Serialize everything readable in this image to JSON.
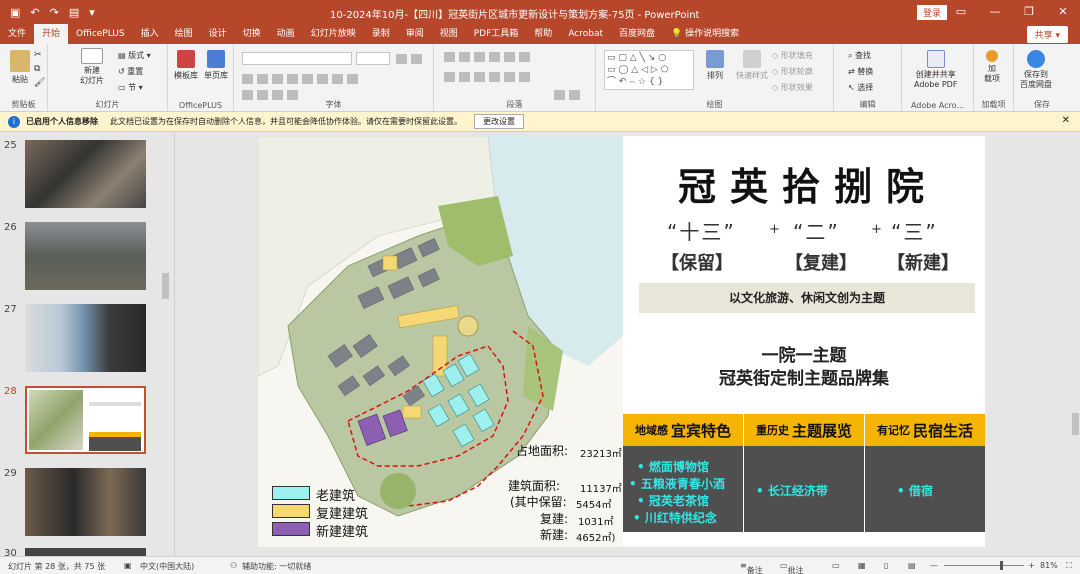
{
  "window": {
    "title": "10-2024年10月-【四川】冠英街片区城市更新设计与策划方案-75页 - PowerPoint",
    "login": "登录"
  },
  "tabs": [
    "文件",
    "开始",
    "OfficePLUS",
    "插入",
    "绘图",
    "设计",
    "切换",
    "动画",
    "幻灯片放映",
    "录制",
    "审阅",
    "视图",
    "PDF工具箱",
    "帮助",
    "Acrobat",
    "百度网盘",
    "操作说明搜索"
  ],
  "share": "共享",
  "ribbon": {
    "groups": [
      "剪贴板",
      "幻灯片",
      "OfficePLUS",
      "字体",
      "段落",
      "绘图",
      "编辑",
      "Adobe Acro...",
      "加载项",
      "保存"
    ],
    "paste": "粘贴",
    "new_slide": "新建\n幻灯片",
    "layout": "版式",
    "reset": "重置",
    "section": "节",
    "template_lib": "模板库",
    "single_lib": "单页库",
    "arrange": "排列",
    "quick_styles": "快速样式",
    "shape_fill": "形状填充",
    "shape_outline": "形状轮廓",
    "shape_effect": "形状效果",
    "find": "查找",
    "replace": "替换",
    "select": "选择",
    "create_share_pdf": "创建并共享\nAdobe PDF",
    "addins": "加\n载项",
    "save_baidu": "保存到\n百度网盘"
  },
  "infobar": {
    "title": "已启用个人信息移除",
    "message": "此文档已设置为在保存时自动删除个人信息，并且可能会降低协作体验。请仅在需要时保留此设置。",
    "button": "更改设置"
  },
  "thumbnails": [
    {
      "num": "25",
      "active": false
    },
    {
      "num": "26",
      "active": false
    },
    {
      "num": "27",
      "active": false
    },
    {
      "num": "28",
      "active": true
    },
    {
      "num": "29",
      "active": false
    },
    {
      "num": "30",
      "active": false
    }
  ],
  "slide": {
    "title": "冠英拾捌院",
    "num1": "“十三”",
    "num2": "“二”",
    "num3": "“三”",
    "plus": "+",
    "bracket1": "【保留】",
    "bracket2": "【复建】",
    "bracket3": "【新建】",
    "theme": "以文化旅游、休闲文创为主题",
    "sub1": "一院一主题",
    "sub2": "冠英街定制主题品牌集",
    "categories": [
      {
        "small": "地域感",
        "big": "宜宾特色",
        "items": [
          "燃面博物馆",
          "五粮液青春小酒",
          "冠英老茶馆",
          "川红特供纪念"
        ]
      },
      {
        "small": "重历史",
        "big": "主题展览",
        "items": [
          "长江经济带"
        ]
      },
      {
        "small": "有记忆",
        "big": "民宿生活",
        "items": [
          "借宿"
        ]
      }
    ],
    "stats": {
      "land_label": "占地面积:",
      "land_value": "23213㎡",
      "build_label": "建筑面积:",
      "build_value": "11137㎡",
      "keep_label": "(其中保留:",
      "keep_value": "5454㎡",
      "rebuild_label": "复建:",
      "rebuild_value": "1031㎡",
      "new_label": "新建:",
      "new_value": "4652㎡)"
    },
    "legend": [
      {
        "label": "老建筑",
        "color": "#9ef0ef"
      },
      {
        "label": "复建建筑",
        "color": "#f5d874"
      },
      {
        "label": "新建建筑",
        "color": "#8c5fb3"
      }
    ]
  },
  "status": {
    "slide_info": "幻灯片 第 28 张，共 75 张",
    "language": "中文(中国大陆)",
    "accessibility": "辅助功能: 一切就绪",
    "notes": "备注",
    "comments": "批注",
    "zoom": "81%"
  }
}
